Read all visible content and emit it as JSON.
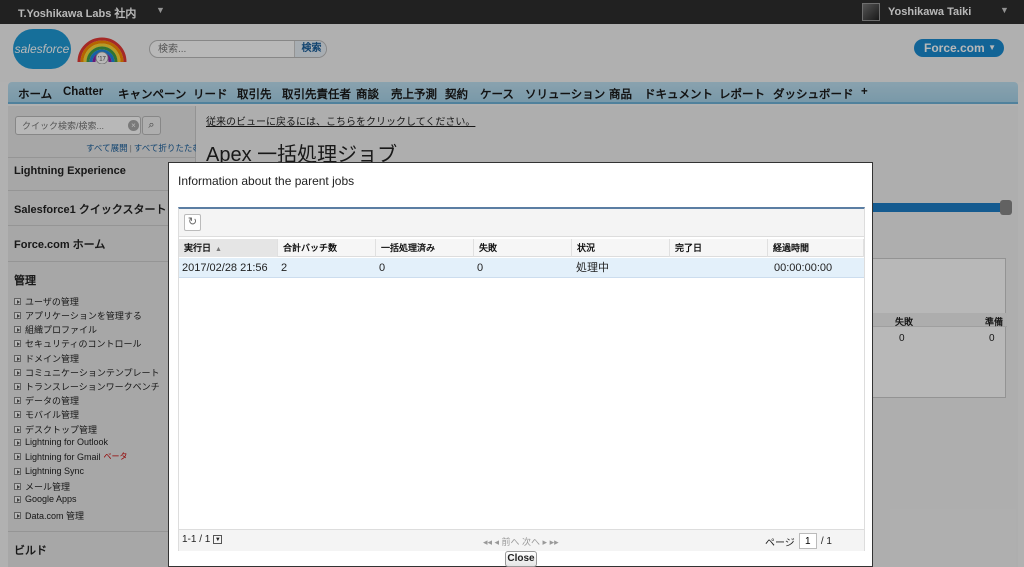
{
  "topbar": {
    "org_name": "T.Yoshikawa Labs 社内",
    "user_name": "Yoshikawa Taiki"
  },
  "header": {
    "logo_text": "salesforce",
    "badge_text": "'17",
    "search_placeholder": "検索...",
    "search_button": "検索",
    "app_name": "Force.com"
  },
  "tabs": [
    "ホーム",
    "Chatter",
    "キャンペーン",
    "リード",
    "取引先",
    "取引先責任者",
    "商談",
    "売上予測",
    "契約",
    "ケース",
    "ソリューション",
    "商品",
    "ドキュメント",
    "レポート",
    "ダッシュボード",
    "+"
  ],
  "sidebar": {
    "quick_find_placeholder": "クイック検索/検索...",
    "expand_all": "すべて展開",
    "collapse_all": "すべて折りたたむ",
    "sections": [
      "Lightning Experience",
      "Salesforce1 クイックスタート",
      "Force.com ホーム",
      "管理"
    ],
    "admin_items": [
      "ユーザの管理",
      "アプリケーションを管理する",
      "組織プロファイル",
      "セキュリティのコントロール",
      "ドメイン管理",
      "コミュニケーションテンプレート",
      "トランスレーションワークベンチ",
      "データの管理",
      "モバイル管理",
      "デスクトップ管理",
      "Lightning for Outlook",
      "Lightning for Gmail",
      "Lightning Sync",
      "メール管理",
      "Google Apps",
      "Data.com 管理"
    ],
    "beta_label": "ベータ",
    "build_section": "ビルド"
  },
  "main": {
    "back_link": "従来のビューに戻るには、こちらをクリックしてください。",
    "page_title": "Apex 一括処理ジョブ",
    "bg_headers": [
      "失敗",
      "準備"
    ],
    "bg_values": [
      "0",
      "0"
    ]
  },
  "dialog": {
    "title": "Information about the parent jobs",
    "columns": [
      "実行日",
      "合計バッチ数",
      "一括処理済み",
      "失敗",
      "状況",
      "完了日",
      "経過時間"
    ],
    "rows": [
      [
        "2017/02/28 21:56",
        "2",
        "0",
        "0",
        "処理中",
        "",
        "00:00:00:00"
      ]
    ],
    "footer": {
      "range": "1-1 / 1",
      "pager": "◂◂ ◂ 前へ  次へ ▸ ▸▸",
      "page_label": "ページ",
      "page_value": "1",
      "page_total": "/ 1"
    },
    "close_button": "Close"
  }
}
